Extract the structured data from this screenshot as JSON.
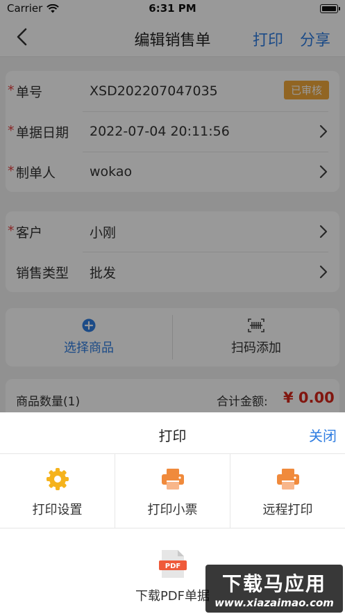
{
  "status_bar": {
    "carrier": "Carrier",
    "time": "6:31 PM"
  },
  "nav": {
    "title": "编辑销售单",
    "print": "打印",
    "share": "分享"
  },
  "order": {
    "number_label": "单号",
    "number_value": "XSD202207047035",
    "status_badge": "已审核",
    "date_label": "单据日期",
    "date_value": "2022-07-04 20:11:56",
    "creator_label": "制单人",
    "creator_value": "wokao"
  },
  "customer": {
    "customer_label": "客户",
    "customer_value": "小刚",
    "sale_type_label": "销售类型",
    "sale_type_value": "批发"
  },
  "actions": {
    "select_goods": "选择商品",
    "scan_add": "扫码添加"
  },
  "summary": {
    "count_label": "商品数量(1)",
    "total_label": "合计金额:",
    "total_value": "¥ 0.00"
  },
  "required_mark": "*",
  "sheet": {
    "title": "打印",
    "close": "关闭",
    "options": [
      {
        "label": "打印设置",
        "icon": "gear-icon"
      },
      {
        "label": "打印小票",
        "icon": "printer-icon"
      },
      {
        "label": "远程打印",
        "icon": "printer-icon"
      }
    ],
    "pdf_label": "下载PDF单据",
    "pdf_icon_text": "PDF"
  },
  "watermark": {
    "line1": "下载马应用",
    "line2": "www.xiazaimao.com"
  },
  "colors": {
    "accent": "#2f7de1",
    "required": "#e54040",
    "badge": "#f2a93b",
    "amount": "#d8261a",
    "icon_orange": "#f08a3c"
  }
}
